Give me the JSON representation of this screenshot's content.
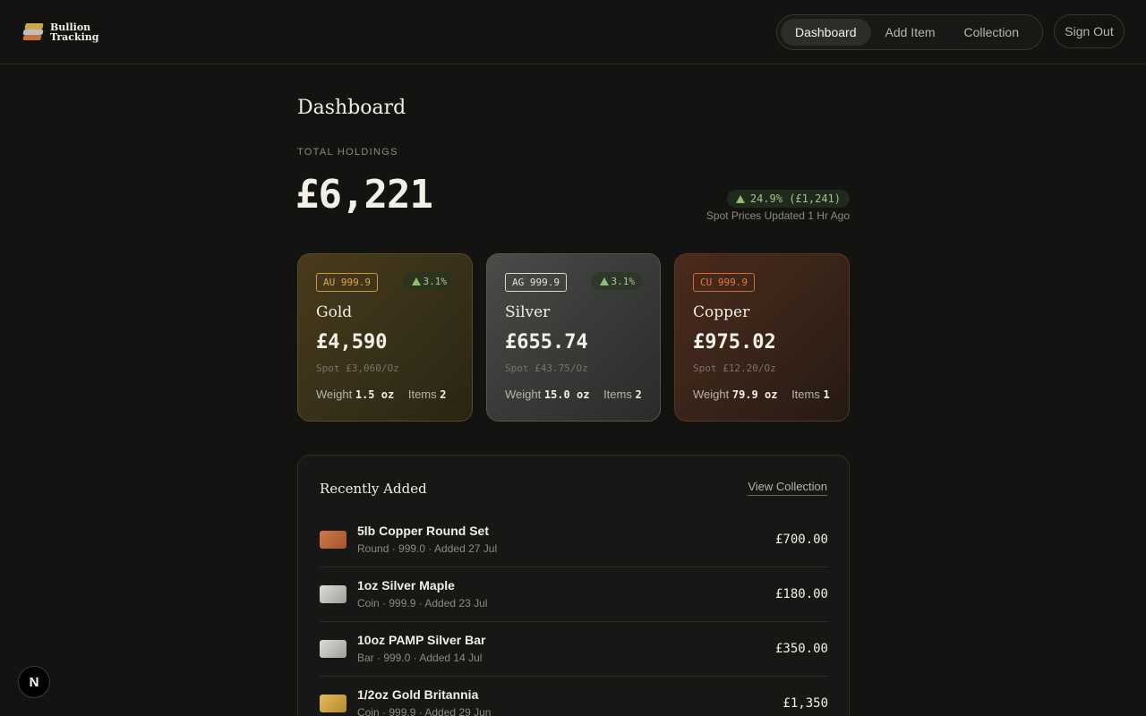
{
  "app": {
    "brand_line1": "Bullion",
    "brand_line2": "Tracking"
  },
  "nav": {
    "items": [
      {
        "label": "Dashboard",
        "active": true
      },
      {
        "label": "Add Item",
        "active": false
      },
      {
        "label": "Collection",
        "active": false
      }
    ],
    "sign_out": "Sign Out"
  },
  "page": {
    "title": "Dashboard"
  },
  "holdings": {
    "label": "TOTAL HOLDINGS",
    "value": "£6,221",
    "change": "24.9% (£1,241)",
    "updated": "Spot Prices Updated 1 Hr Ago",
    "change_color": "#8fbc6e"
  },
  "metals": [
    {
      "purity": "AU 999.9",
      "change": "3.1%",
      "name": "Gold",
      "value": "£4,590",
      "spot": "Spot £3,060/Oz",
      "weight_label": "Weight",
      "weight": "1.5 oz",
      "items_label": "Items",
      "items": "2"
    },
    {
      "purity": "AG 999.9",
      "change": "3.1%",
      "name": "Silver",
      "value": "£655.74",
      "spot": "Spot £43.75/Oz",
      "weight_label": "Weight",
      "weight": "15.0 oz",
      "items_label": "Items",
      "items": "2"
    },
    {
      "purity": "CU 999.9",
      "change": "",
      "name": "Copper",
      "value": "£975.02",
      "spot": "Spot £12.20/Oz",
      "weight_label": "Weight",
      "weight": "79.9 oz",
      "items_label": "Items",
      "items": "1"
    }
  ],
  "recent": {
    "title": "Recently Added",
    "view_link": "View Collection",
    "items": [
      {
        "name": "5lb Copper Round Set",
        "meta": "Round · 999.0 · Added 27 Jul",
        "value": "£700.00",
        "color": "#c0673c"
      },
      {
        "name": "1oz Silver Maple",
        "meta": "Coin · 999.9 · Added 23 Jul",
        "value": "£180.00",
        "color": "#c3c4c0"
      },
      {
        "name": "10oz PAMP Silver Bar",
        "meta": "Bar · 999.0 · Added 14 Jul",
        "value": "£350.00",
        "color": "#c3c4c0"
      },
      {
        "name": "1/2oz Gold Britannia",
        "meta": "Coin · 999.9 · Added 29 Jun",
        "value": "£1,350",
        "color": "#d4a945"
      }
    ]
  },
  "dev_badge": "N"
}
